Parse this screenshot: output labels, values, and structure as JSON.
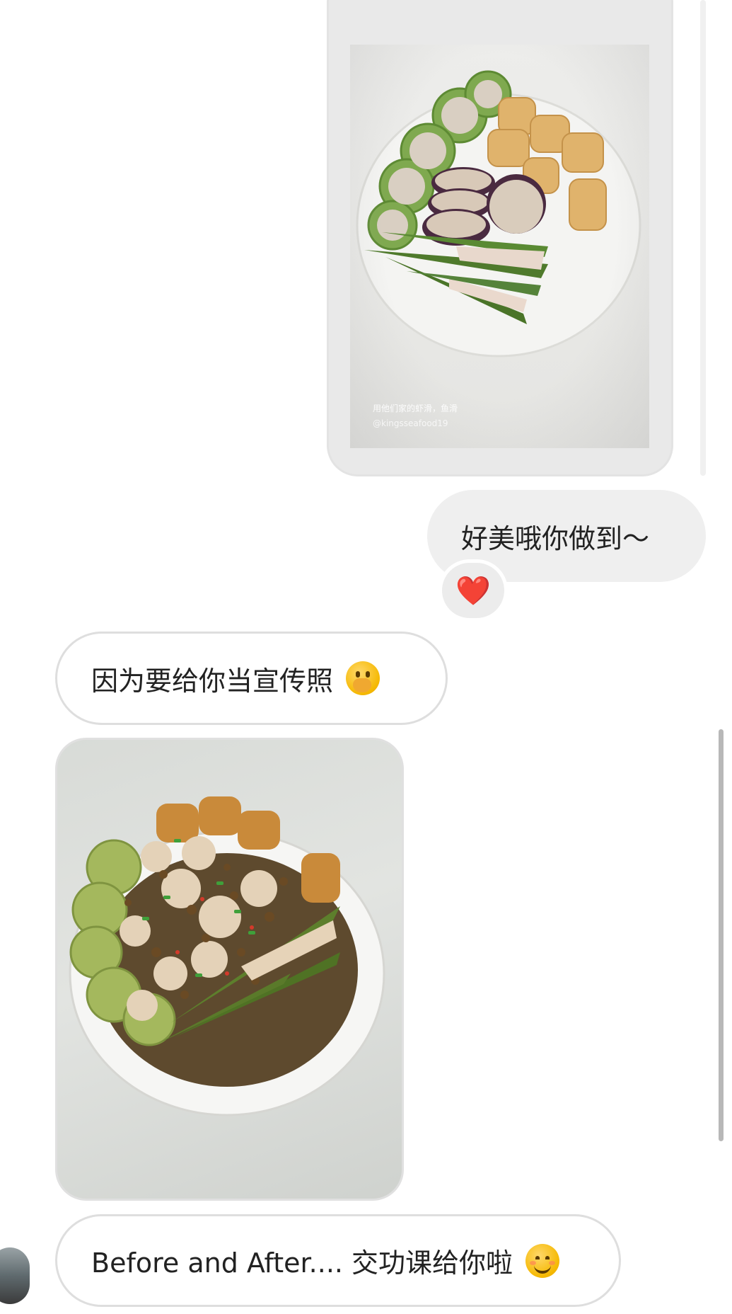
{
  "messages": {
    "sent_image": {
      "caption_line1": "用他们家的虾滑，鱼滑",
      "caption_line2": "@kingsseafood19"
    },
    "sent_text": "好美哦你做到～",
    "reaction": "❤️",
    "received_text_1": "因为要给你当宣传照",
    "received_text_1_emoji": "face-with-hand-over-mouth",
    "received_image": {
      "description_icon": "photo-of-stuffed-vegetables-cooked"
    },
    "received_text_2": "Before and After.... 交功课给你啦",
    "received_text_2_emoji": "smiling-face"
  },
  "colors": {
    "sent_bubble": "#efefef",
    "received_border": "#dedede",
    "heart": "#e0202a"
  }
}
